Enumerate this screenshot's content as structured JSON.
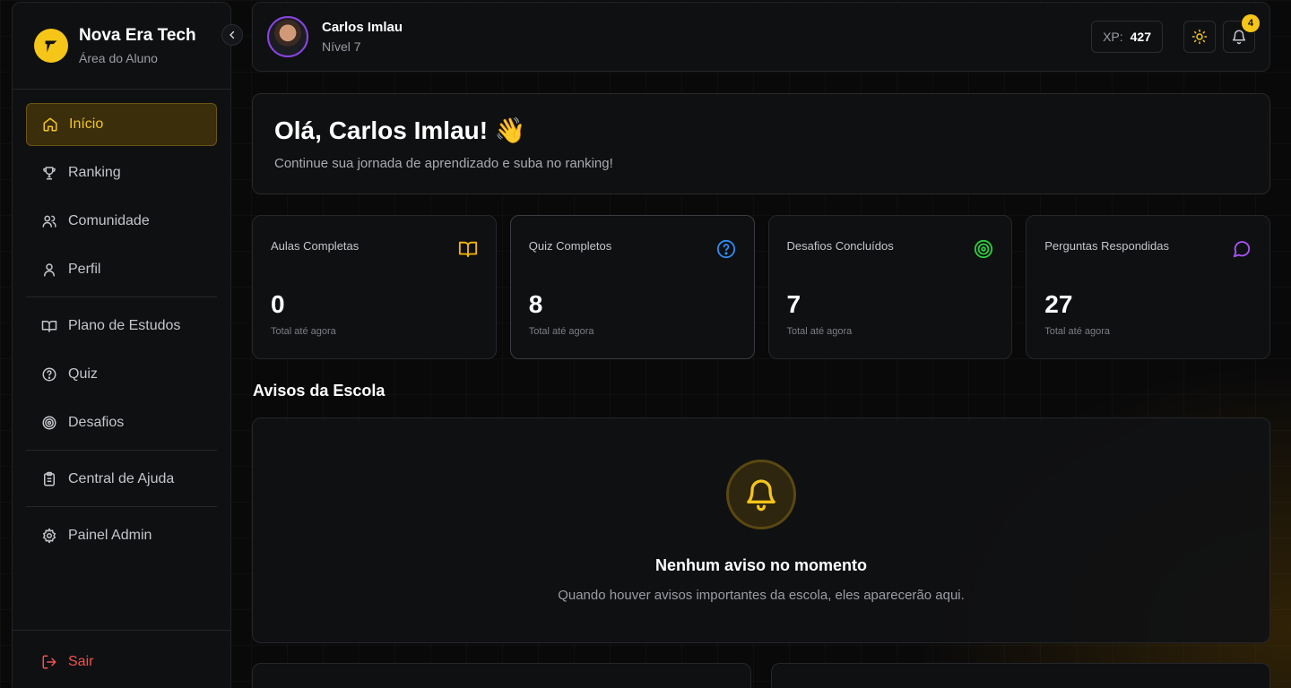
{
  "brand": {
    "name": "Nova Era Tech",
    "subtitle": "Área do Aluno"
  },
  "nav": {
    "items": [
      {
        "label": "Início",
        "icon": "home-icon",
        "active": true
      },
      {
        "label": "Ranking",
        "icon": "trophy-icon"
      },
      {
        "label": "Comunidade",
        "icon": "users-icon"
      },
      {
        "label": "Perfil",
        "icon": "user-icon"
      },
      {
        "label": "Plano de Estudos",
        "icon": "book-icon"
      },
      {
        "label": "Quiz",
        "icon": "help-circle-icon"
      },
      {
        "label": "Desafios",
        "icon": "target-icon"
      },
      {
        "label": "Central de Ajuda",
        "icon": "clipboard-icon"
      },
      {
        "label": "Painel Admin",
        "icon": "gear-icon"
      }
    ],
    "logout": "Sair"
  },
  "user": {
    "name": "Carlos Imlau",
    "level": "Nível 7"
  },
  "xp": {
    "label": "XP:",
    "value": "427"
  },
  "notifications": {
    "count": "4"
  },
  "welcome": {
    "title": "Olá, Carlos Imlau! 👋",
    "subtitle": "Continue sua jornada de aprendizado e suba no ranking!"
  },
  "stats": [
    {
      "title": "Aulas Completas",
      "value": "0",
      "sub": "Total até agora",
      "icon": "book-open-icon",
      "color": "#f5b800"
    },
    {
      "title": "Quiz Completos",
      "value": "8",
      "sub": "Total até agora",
      "icon": "help-circle-icon",
      "color": "#2f8cf0"
    },
    {
      "title": "Desafios Concluídos",
      "value": "7",
      "sub": "Total até agora",
      "icon": "target-icon",
      "color": "#2ecc40"
    },
    {
      "title": "Perguntas Respondidas",
      "value": "27",
      "sub": "Total até agora",
      "icon": "message-circle-icon",
      "color": "#a855f7"
    }
  ],
  "notices": {
    "section_title": "Avisos da Escola",
    "empty_title": "Nenhum aviso no momento",
    "empty_text": "Quando houver avisos importantes da escola, eles aparecerão aqui."
  },
  "colors": {
    "accent": "#f5c518",
    "danger": "#f0524f"
  }
}
